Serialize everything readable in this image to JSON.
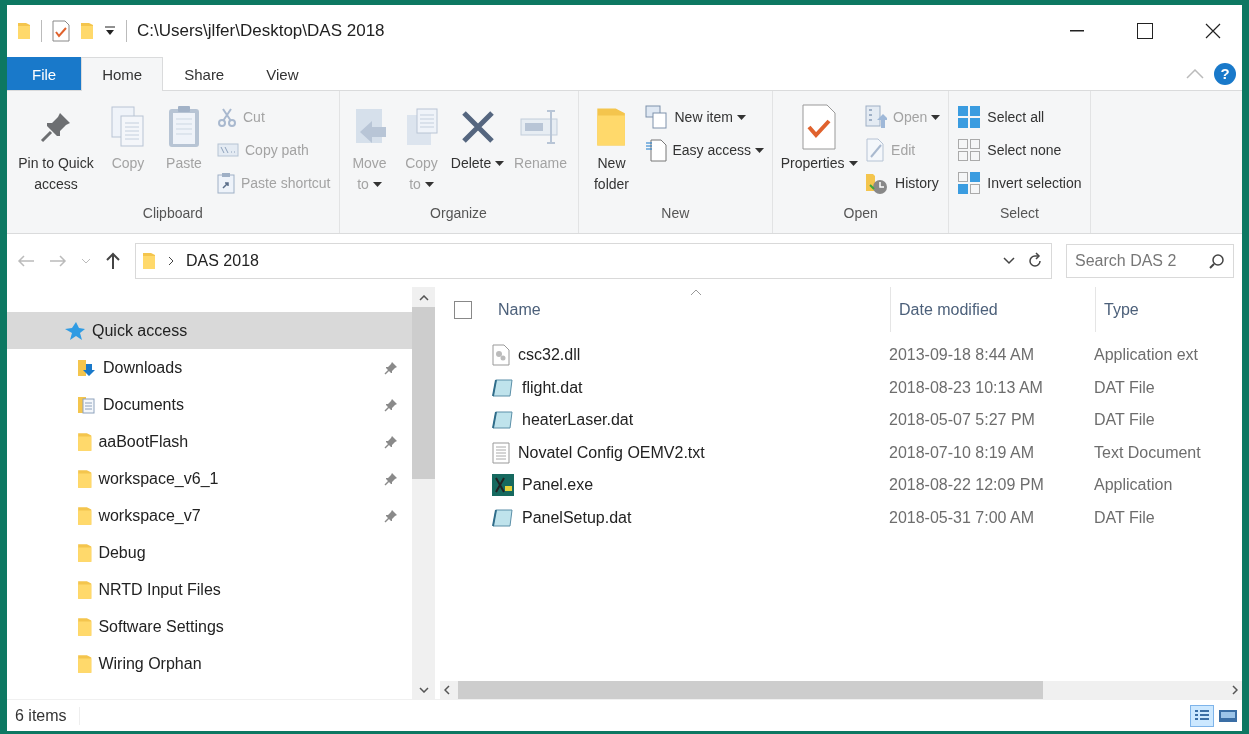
{
  "title_bar": {
    "path": "C:\\Users\\jlfer\\Desktop\\DAS 2018"
  },
  "ribbon_tabs": [
    {
      "label": "File",
      "kind": "file",
      "selected": false
    },
    {
      "label": "Home",
      "kind": "tab",
      "selected": true
    },
    {
      "label": "Share",
      "kind": "tab",
      "selected": false
    },
    {
      "label": "View",
      "kind": "tab",
      "selected": false
    }
  ],
  "help": "?",
  "ribbon_groups": [
    {
      "label": "Clipboard",
      "items": [
        {
          "kind": "large",
          "label": "Pin to Quick access",
          "disabled": false,
          "dropdown": false
        },
        {
          "kind": "large",
          "label": "Copy",
          "disabled": true,
          "dropdown": false
        },
        {
          "kind": "large",
          "label": "Paste",
          "disabled": true,
          "dropdown": false
        },
        {
          "kind": "stack",
          "items": [
            {
              "label": "Cut",
              "disabled": true,
              "dropdown": false
            },
            {
              "label": "Copy path",
              "disabled": true,
              "dropdown": false
            },
            {
              "label": "Paste shortcut",
              "disabled": true,
              "dropdown": false
            }
          ]
        }
      ]
    },
    {
      "label": "Organize",
      "items": [
        {
          "kind": "large",
          "label": "Move to",
          "disabled": true,
          "dropdown": true
        },
        {
          "kind": "large",
          "label": "Copy to",
          "disabled": true,
          "dropdown": true
        },
        {
          "kind": "large",
          "label": "Delete",
          "disabled": false,
          "dropdown": true
        },
        {
          "kind": "large",
          "label": "Rename",
          "disabled": true,
          "dropdown": false
        }
      ]
    },
    {
      "label": "New",
      "items": [
        {
          "kind": "large",
          "label": "New folder",
          "disabled": false,
          "dropdown": false
        },
        {
          "kind": "stack",
          "items": [
            {
              "label": "New item",
              "disabled": false,
              "dropdown": true
            },
            {
              "label": "Easy access",
              "disabled": false,
              "dropdown": true
            }
          ]
        }
      ]
    },
    {
      "label": "Open",
      "items": [
        {
          "kind": "large",
          "label": "Properties",
          "disabled": false,
          "dropdown": true
        },
        {
          "kind": "stack",
          "items": [
            {
              "label": "Open",
              "disabled": true,
              "dropdown": true
            },
            {
              "label": "Edit",
              "disabled": true,
              "dropdown": false
            },
            {
              "label": "History",
              "disabled": false,
              "dropdown": false
            }
          ]
        }
      ]
    },
    {
      "label": "Select",
      "items": [
        {
          "kind": "stack",
          "items": [
            {
              "label": "Select all",
              "disabled": false,
              "dropdown": false
            },
            {
              "label": "Select none",
              "disabled": false,
              "dropdown": false
            },
            {
              "label": "Invert selection",
              "disabled": false,
              "dropdown": false
            }
          ]
        }
      ]
    }
  ],
  "address_bar": {
    "path": "DAS 2018"
  },
  "search": {
    "placeholder": "Search DAS 2"
  },
  "navigation_pane": [
    {
      "label": "Quick access",
      "kind": "quick",
      "selected": true,
      "children": [
        {
          "label": "Downloads",
          "kind": "downloads",
          "pinned": true,
          "selected": false
        },
        {
          "label": "Documents",
          "kind": "documents",
          "pinned": true,
          "selected": false
        },
        {
          "label": "aaBootFlash",
          "kind": "folder",
          "pinned": true,
          "selected": false
        },
        {
          "label": "workspace_v6_1",
          "kind": "folder",
          "pinned": true,
          "selected": false
        },
        {
          "label": "workspace_v7",
          "kind": "folder",
          "pinned": true,
          "selected": false
        },
        {
          "label": "Debug",
          "kind": "folder",
          "pinned": false,
          "selected": false
        },
        {
          "label": "NRTD Input Files",
          "kind": "folder",
          "pinned": false,
          "selected": false
        },
        {
          "label": "Software Settings",
          "kind": "folder",
          "pinned": false,
          "selected": false
        },
        {
          "label": "Wiring Orphan",
          "kind": "folder",
          "pinned": false,
          "selected": false
        }
      ]
    }
  ],
  "file_list": {
    "select_all_checked": false,
    "columns": [
      {
        "label": "Name",
        "sorted": true
      },
      {
        "label": "Date modified",
        "sorted": false
      },
      {
        "label": "Type",
        "sorted": false
      }
    ],
    "rows": [
      {
        "kind": "dll",
        "name": "csc32.dll",
        "date": "2013-09-18 8:44 AM",
        "type": "Application ext"
      },
      {
        "kind": "dat",
        "name": "flight.dat",
        "date": "2018-08-23 10:13 AM",
        "type": "DAT File"
      },
      {
        "kind": "dat",
        "name": "heaterLaser.dat",
        "date": "2018-05-07 5:27 PM",
        "type": "DAT File"
      },
      {
        "kind": "txt",
        "name": "Novatel Config OEMV2.txt",
        "date": "2018-07-10 8:19 AM",
        "type": "Text Document"
      },
      {
        "kind": "exe",
        "name": "Panel.exe",
        "date": "2018-08-22 12:09 PM",
        "type": "Application"
      },
      {
        "kind": "dat",
        "name": "PanelSetup.dat",
        "date": "2018-05-31 7:00 AM",
        "type": "DAT File"
      }
    ]
  },
  "status_bar": {
    "count": "6 items",
    "views": [
      {
        "selected": true
      },
      {
        "selected": false
      }
    ]
  }
}
